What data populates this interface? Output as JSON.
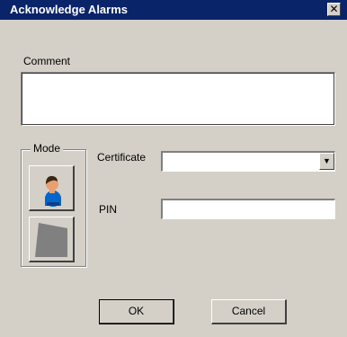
{
  "window": {
    "title": "Acknowledge Alarms",
    "close_icon": "close-icon",
    "close_glyph": "✕"
  },
  "comment": {
    "label": "Comment",
    "value": ""
  },
  "mode": {
    "legend": "Mode",
    "buttons": [
      {
        "icon": "user-icon"
      },
      {
        "icon": "certificate-shape-icon"
      }
    ]
  },
  "certificate": {
    "label": "Certificate",
    "selected": "",
    "dropdown_icon": "chevron-down-icon",
    "dropdown_glyph": "▼"
  },
  "pin": {
    "label": "PIN",
    "value": ""
  },
  "buttons": {
    "ok_label": "OK",
    "cancel_label": "Cancel"
  },
  "colors": {
    "title_bar": "#0a246a",
    "dialog_bg": "#d4d0c8",
    "accent_blue": "#0066cc",
    "skin": "#e8a070"
  }
}
